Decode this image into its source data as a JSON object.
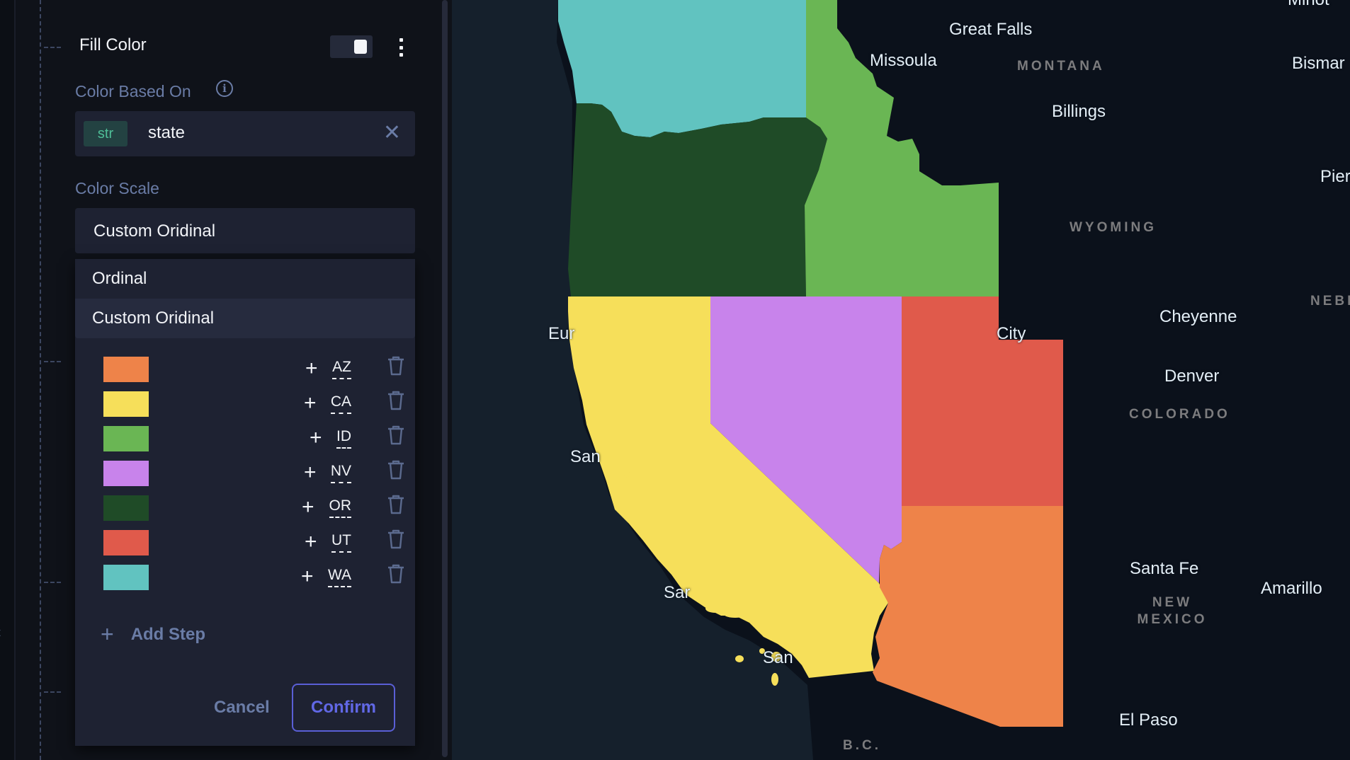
{
  "panel": {
    "title": "Fill Color",
    "toggle_on": true,
    "color_based_on_label": "Color Based On",
    "field": {
      "type_badge": "str",
      "value": "state"
    },
    "color_scale_label": "Color Scale",
    "color_scale_selected": "Custom Oridinal",
    "dropdown_options": [
      {
        "label": "Ordinal",
        "selected": false
      },
      {
        "label": "Custom Oridinal",
        "selected": true
      }
    ],
    "steps": [
      {
        "value": "AZ",
        "color": "#ee8349"
      },
      {
        "value": "CA",
        "color": "#f6df5a"
      },
      {
        "value": "ID",
        "color": "#6ab654"
      },
      {
        "value": "NV",
        "color": "#c883eb"
      },
      {
        "value": "OR",
        "color": "#1f4b27"
      },
      {
        "value": "UT",
        "color": "#e05a4b"
      },
      {
        "value": "WA",
        "color": "#61c3c0"
      }
    ],
    "add_step_label": "Add Step",
    "cancel_label": "Cancel",
    "confirm_label": "Confirm",
    "side_cut_text": "t"
  },
  "map": {
    "cities": [
      {
        "name": "Great Falls"
      },
      {
        "name": "Missoula"
      },
      {
        "name": "Billings"
      },
      {
        "name": "Bismar"
      },
      {
        "name": "Pier"
      },
      {
        "name": "Cheyenne"
      },
      {
        "name": "Denver"
      },
      {
        "name": "Santa Fe"
      },
      {
        "name": "Amarillo"
      },
      {
        "name": "El Paso"
      },
      {
        "name": "Eur"
      },
      {
        "name": "City"
      },
      {
        "name": "San"
      },
      {
        "name": "Sar"
      },
      {
        "name": "San"
      },
      {
        "name": "Minot"
      }
    ],
    "regions": [
      {
        "name": "MONTANA"
      },
      {
        "name": "WYOMING"
      },
      {
        "name": "NEBR"
      },
      {
        "name": "COLORADO"
      },
      {
        "name": "NEW MEXICO"
      },
      {
        "name": "B.C."
      }
    ],
    "ocean_color": "#15202c",
    "land_color": "#0b111b"
  }
}
